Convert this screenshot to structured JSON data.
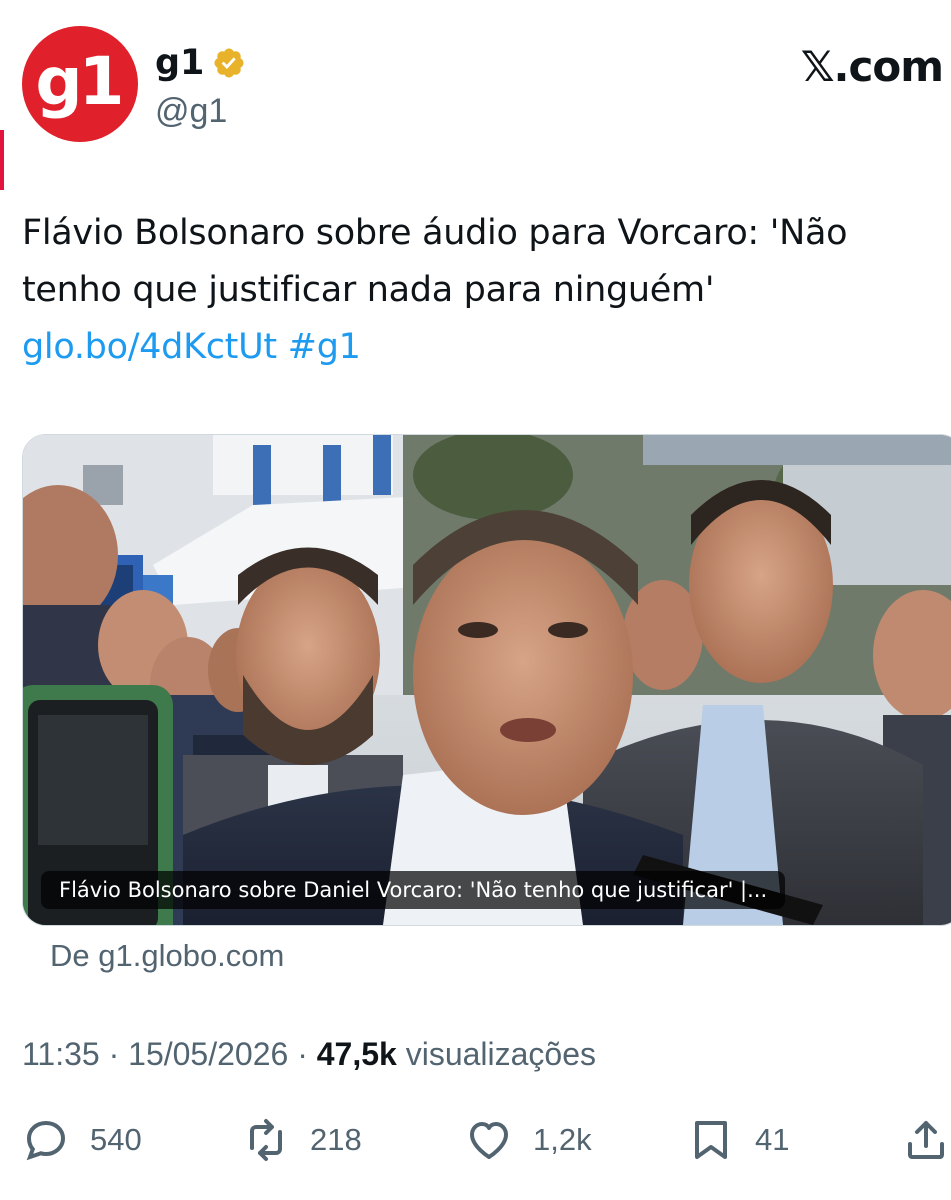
{
  "account": {
    "display_name": "g1",
    "handle": "@g1",
    "avatar_text": "g1",
    "verified": true,
    "brand_color": "#e0202a"
  },
  "site_brand": "𝕏.com",
  "tweet": {
    "text": "Flávio Bolsonaro sobre áudio para Vorcaro: 'Não tenho que justificar nada para ninguém' ",
    "link": "glo.bo/4dKctUt",
    "hashtag": "#g1"
  },
  "card": {
    "caption": "Flávio Bolsonaro sobre Daniel Vorcaro: 'Não tenho que justificar' |...",
    "source": "De g1.globo.com"
  },
  "meta": {
    "time": "11:35",
    "separator": " · ",
    "date": "15/05/2026",
    "views_count": "47,5k",
    "views_label": " visualizações"
  },
  "actions": {
    "replies": "540",
    "reposts": "218",
    "likes": "1,2k",
    "bookmarks": "41"
  },
  "colors": {
    "text": "#0f1419",
    "secondary": "#536471",
    "link": "#1d9bf0",
    "verified": "#e8b32a"
  }
}
